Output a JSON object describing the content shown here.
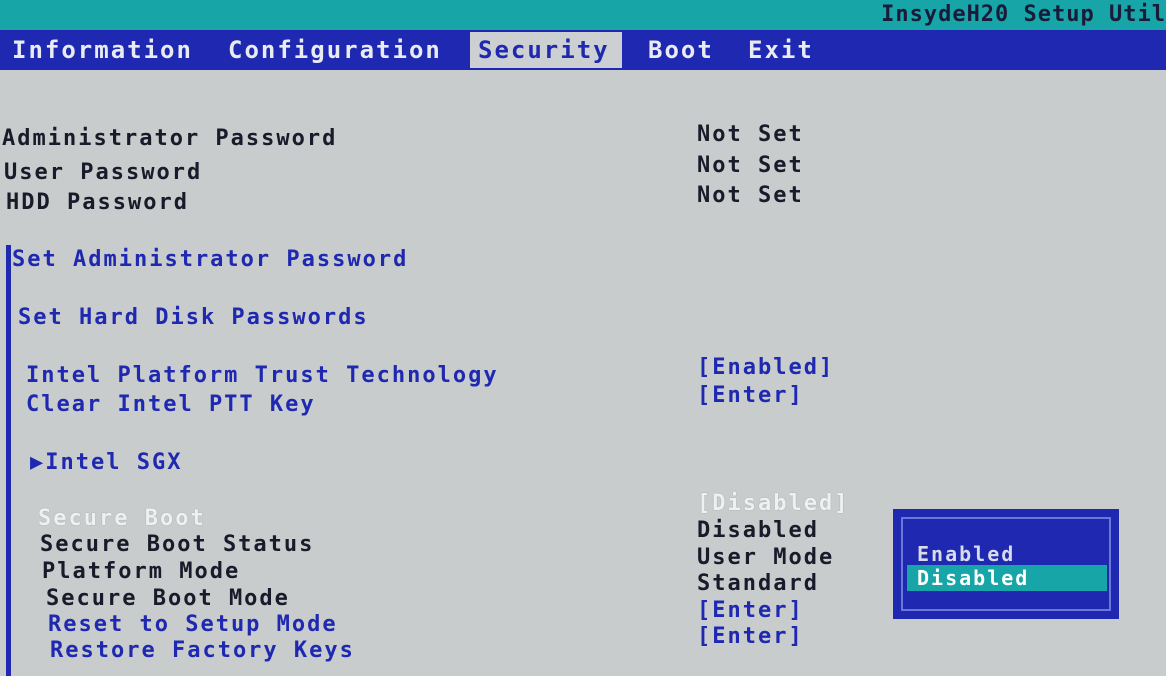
{
  "app": {
    "title": "InsydeH20 Setup Util"
  },
  "menu": {
    "tabs": [
      {
        "label": "Information"
      },
      {
        "label": "Configuration"
      },
      {
        "label": "Security"
      },
      {
        "label": "Boot"
      },
      {
        "label": "Exit"
      }
    ],
    "active_tab": "Security"
  },
  "security": {
    "admin_password": {
      "label": "Administrator Password",
      "value": "Not Set"
    },
    "user_password": {
      "label": "User Password",
      "value": "Not Set"
    },
    "hdd_password": {
      "label": "HDD Password",
      "value": "Not Set"
    },
    "set_admin_password": {
      "label": "Set Administrator Password"
    },
    "set_hdd_passwords": {
      "label": "Set Hard Disk Passwords"
    },
    "intel_ptt": {
      "label": "Intel Platform Trust Technology",
      "value": "[Enabled]"
    },
    "clear_ptt_key": {
      "label": "Clear Intel PTT Key",
      "value": "[Enter]"
    },
    "intel_sgx": {
      "label": "▶Intel SGX"
    },
    "secure_boot": {
      "label": "Secure Boot",
      "value": "[Disabled]"
    },
    "secure_boot_status": {
      "label": "Secure Boot Status",
      "value": "Disabled"
    },
    "platform_mode": {
      "label": "Platform Mode",
      "value": "User Mode"
    },
    "secure_boot_mode": {
      "label": "Secure Boot Mode",
      "value": "Standard"
    },
    "reset_setup_mode": {
      "label": "Reset to Setup Mode",
      "value": "[Enter]"
    },
    "restore_factory_keys": {
      "label": "Restore Factory Keys",
      "value": "[Enter]"
    }
  },
  "popup": {
    "options": [
      "Enabled",
      "Disabled"
    ],
    "selected": "Disabled"
  },
  "colors": {
    "background": "#c9cccd",
    "menu_bar": "#1e28b0",
    "accent_teal": "#17a5a8",
    "link_text": "#1e28b0"
  }
}
